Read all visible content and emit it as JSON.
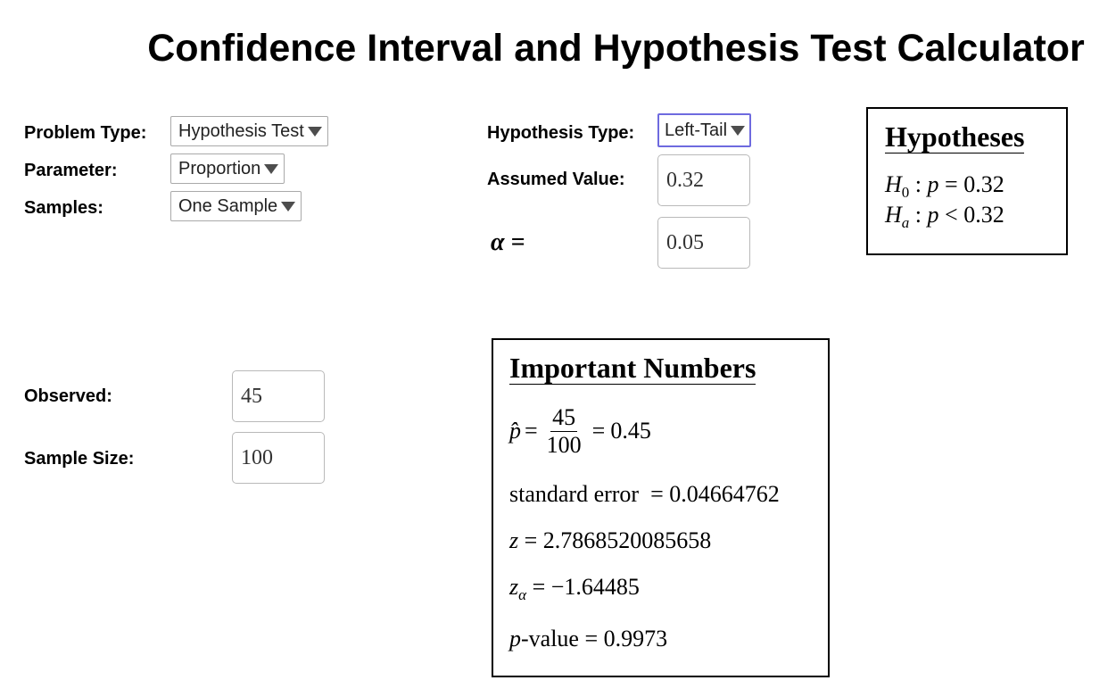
{
  "title": "Confidence Interval and Hypothesis Test Calculator",
  "controls": {
    "problem_type": {
      "label": "Problem Type:",
      "value": "Hypothesis Test"
    },
    "parameter": {
      "label": "Parameter:",
      "value": "Proportion"
    },
    "samples": {
      "label": "Samples:",
      "value": "One Sample"
    },
    "hypothesis_type": {
      "label": "Hypothesis Type:",
      "value": "Left-Tail"
    },
    "assumed_value": {
      "label": "Assumed Value:",
      "value": "0.32"
    },
    "alpha": {
      "label": "α =",
      "value": "0.05"
    },
    "observed": {
      "label": "Observed:",
      "value": "45"
    },
    "sample_size": {
      "label": "Sample Size:",
      "value": "100"
    }
  },
  "hypotheses": {
    "title": "Hypotheses",
    "h0": {
      "symbol": "H",
      "sub": "0",
      "param": "p",
      "rel": "=",
      "value": "0.32"
    },
    "ha": {
      "symbol": "H",
      "sub": "a",
      "param": "p",
      "rel": "<",
      "value": "0.32"
    }
  },
  "important_numbers": {
    "title": "Important Numbers",
    "p_hat": {
      "symbol": "p̂",
      "numerator": "45",
      "denominator": "100",
      "value": "0.45"
    },
    "standard_error": {
      "label": "standard error",
      "value": "0.04664762"
    },
    "z": {
      "symbol": "z",
      "value": "2.7868520085658"
    },
    "z_alpha": {
      "symbol": "z",
      "sub": "α",
      "value": "−1.64485"
    },
    "p_value": {
      "symbol": "p",
      "suffix": "-value",
      "value": "0.9973"
    }
  }
}
